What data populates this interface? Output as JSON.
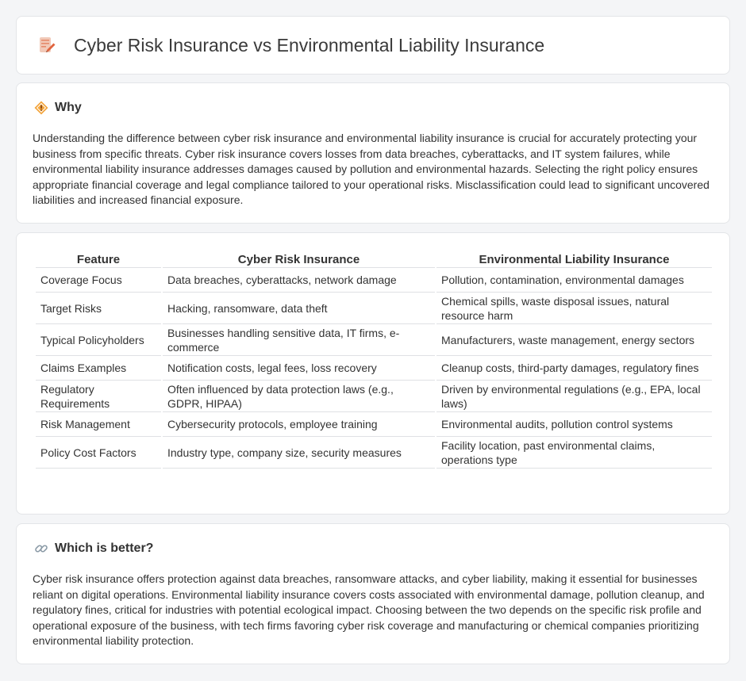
{
  "header": {
    "title": "Cyber Risk Insurance vs Environmental Liability Insurance",
    "icon": "document-pencil-icon"
  },
  "why": {
    "title": "Why",
    "icon": "diamond-sign-icon",
    "text": "Understanding the difference between cyber risk insurance and environmental liability insurance is crucial for accurately protecting your business from specific threats. Cyber risk insurance covers losses from data breaches, cyberattacks, and IT system failures, while environmental liability insurance addresses damages caused by pollution and environmental hazards. Selecting the right policy ensures appropriate financial coverage and legal compliance tailored to your operational risks. Misclassification could lead to significant uncovered liabilities and increased financial exposure."
  },
  "table": {
    "headers": [
      "Feature",
      "Cyber Risk Insurance",
      "Environmental Liability Insurance"
    ],
    "rows": [
      [
        "Coverage Focus",
        "Data breaches, cyberattacks, network damage",
        "Pollution, contamination, environmental damages"
      ],
      [
        "Target Risks",
        "Hacking, ransomware, data theft",
        "Chemical spills, waste disposal issues, natural resource harm"
      ],
      [
        "Typical Policyholders",
        "Businesses handling sensitive data, IT firms, e-commerce",
        "Manufacturers, waste management, energy sectors"
      ],
      [
        "Claims Examples",
        "Notification costs, legal fees, loss recovery",
        "Cleanup costs, third-party damages, regulatory fines"
      ],
      [
        "Regulatory Requirements",
        "Often influenced by data protection laws (e.g., GDPR, HIPAA)",
        "Driven by environmental regulations (e.g., EPA, local laws)"
      ],
      [
        "Risk Management",
        "Cybersecurity protocols, employee training",
        "Environmental audits, pollution control systems"
      ],
      [
        "Policy Cost Factors",
        "Industry type, company size, security measures",
        "Facility location, past environmental claims, operations type"
      ]
    ]
  },
  "better": {
    "title": "Which is better?",
    "icon": "link-icon",
    "text": "Cyber risk insurance offers protection against data breaches, ransomware attacks, and cyber liability, making it essential for businesses reliant on digital operations. Environmental liability insurance covers costs associated with environmental damage, pollution cleanup, and regulatory fines, critical for industries with potential ecological impact. Choosing between the two depends on the specific risk profile and operational exposure of the business, with tech firms favoring cyber risk coverage and manufacturing or chemical companies prioritizing environmental liability protection."
  }
}
